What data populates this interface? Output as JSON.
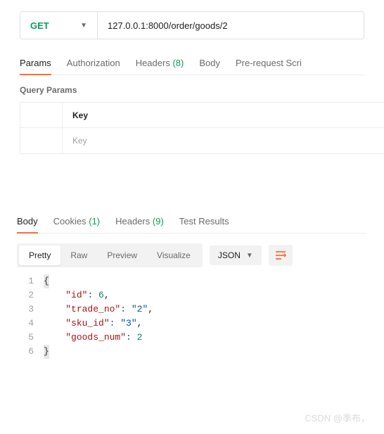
{
  "request": {
    "method": "GET",
    "url": "127.0.0.1:8000/order/goods/2"
  },
  "requestTabs": {
    "params": "Params",
    "authorization": "Authorization",
    "headers": "Headers",
    "headersCount": "(8)",
    "body": "Body",
    "prerequest": "Pre-request Scri"
  },
  "paramsSection": {
    "title": "Query Params",
    "keyHeader": "Key",
    "keyPlaceholder": "Key"
  },
  "responseTabs": {
    "body": "Body",
    "cookies": "Cookies",
    "cookiesCount": "(1)",
    "headers": "Headers",
    "headersCount": "(9)",
    "testResults": "Test Results"
  },
  "viewButtons": {
    "pretty": "Pretty",
    "raw": "Raw",
    "preview": "Preview",
    "visualize": "Visualize"
  },
  "formatSelect": "JSON",
  "responseBody": {
    "lines": [
      "1",
      "2",
      "3",
      "4",
      "5",
      "6"
    ],
    "keys": {
      "id": "\"id\"",
      "trade_no": "\"trade_no\"",
      "sku_id": "\"sku_id\"",
      "goods_num": "\"goods_num\""
    },
    "vals": {
      "id": "6",
      "trade_no": "\"2\"",
      "sku_id": "\"3\"",
      "goods_num": "2"
    }
  },
  "watermark": "CSDN @季布，"
}
